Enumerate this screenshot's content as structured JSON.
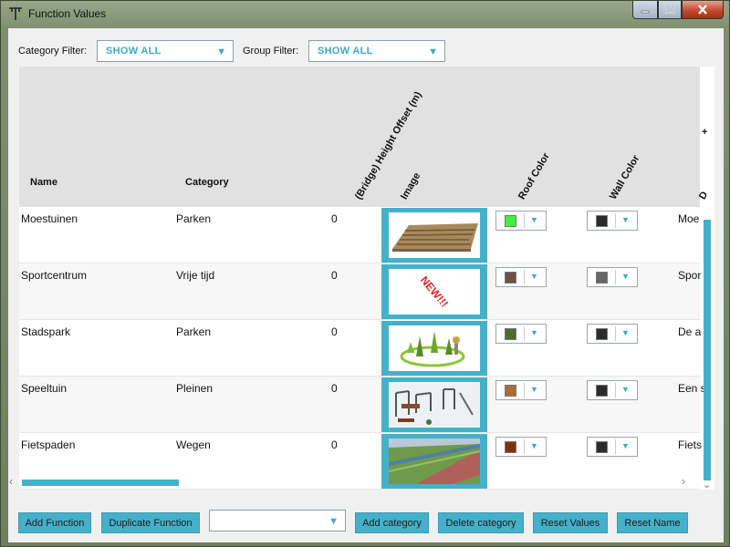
{
  "window": {
    "title": "Function Values"
  },
  "filters": {
    "category_label": "Category Filter:",
    "category_value": "SHOW ALL",
    "group_label": "Group Filter:",
    "group_value": "SHOW ALL"
  },
  "table": {
    "columns": {
      "name": "Name",
      "category": "Category",
      "height_offset": "(Bridge) Height Offset  (m)",
      "image": "Image",
      "roof_color": "Roof Color",
      "wall_color": "Wall Color",
      "description": "D",
      "plus": "+"
    },
    "rows": [
      {
        "name": "Moestuinen",
        "category": "Parken",
        "height": "0",
        "image": "vegetable-garden-image",
        "roof_color": "#44ee44",
        "wall_color": "#2b2b2b",
        "description": "Moe"
      },
      {
        "name": "Sportcentrum",
        "category": "Vrije tijd",
        "height": "0",
        "image": "new-badge-image",
        "image_text": "NEW!!!",
        "roof_color": "#6b5147",
        "wall_color": "#666666",
        "description": "Spor"
      },
      {
        "name": "Stadspark",
        "category": "Parken",
        "height": "0",
        "image": "city-park-image",
        "roof_color": "#506b30",
        "wall_color": "#2b2b2b",
        "description": "De a"
      },
      {
        "name": "Speeltuin",
        "category": "Pleinen",
        "height": "0",
        "image": "playground-image",
        "roof_color": "#a56f3a",
        "wall_color": "#2b2b2b",
        "description": "Een s"
      },
      {
        "name": "Fietspaden",
        "category": "Wegen",
        "height": "0",
        "image": "bike-path-image",
        "roof_color": "#7a3510",
        "wall_color": "#2b2b2b",
        "description": "Fiets"
      }
    ]
  },
  "buttons": {
    "add_function": "Add Function",
    "duplicate_function": "Duplicate Function",
    "add_category": "Add category",
    "delete_category": "Delete category",
    "reset_values": "Reset Values",
    "reset_name": "Reset Name"
  },
  "icons": {
    "app": "tool-icon",
    "minimize": "minimize-icon",
    "maximize": "maximize-icon",
    "close": "close-icon",
    "dropdown": "chevron-down-icon"
  },
  "colors": {
    "accent": "#45b0c9",
    "accent_text": "#3aa9c8",
    "header_bg": "#e1e1e1"
  }
}
